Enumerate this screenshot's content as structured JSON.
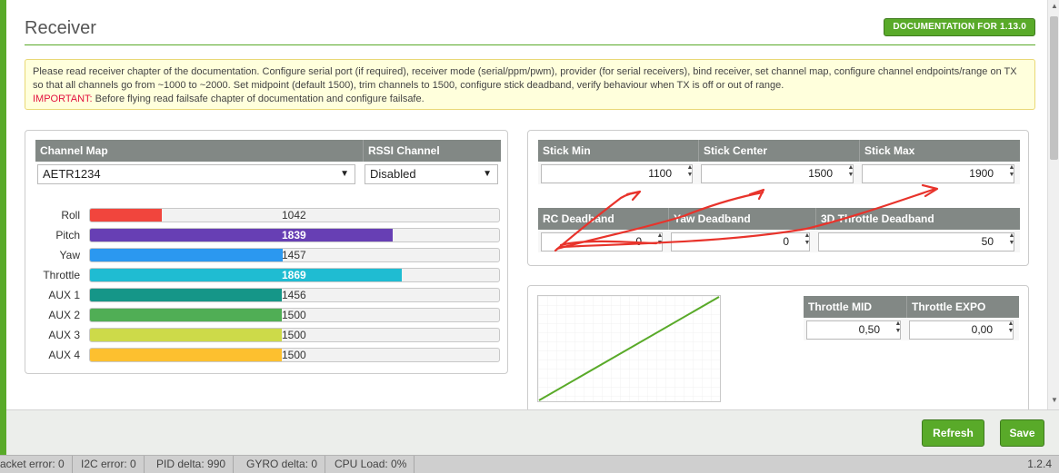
{
  "header": {
    "title": "Receiver",
    "doc_button": "DOCUMENTATION FOR 1.13.0"
  },
  "note": {
    "text": "Please read receiver chapter of the documentation. Configure serial port (if required), receiver mode (serial/ppm/pwm), provider (for serial receivers), bind receiver, set channel map, configure channel endpoints/range on TX so that all channels go from ~1000 to ~2000. Set midpoint (default 1500), trim channels to 1500, configure stick deadband, verify behaviour when TX is off or out of range.",
    "important_label": "IMPORTANT:",
    "important_text": " Before flying read failsafe chapter of documentation and configure failsafe."
  },
  "channel_map": {
    "header": "Channel Map",
    "value": "AETR1234"
  },
  "rssi": {
    "header": "RSSI Channel",
    "value": "Disabled"
  },
  "channels": [
    {
      "label": "Roll",
      "value": "1042",
      "fraction": 0.176,
      "color": "#f1453d"
    },
    {
      "label": "Pitch",
      "value": "1839",
      "fraction": 0.741,
      "color": "#673fb4"
    },
    {
      "label": "Yaw",
      "value": "1457",
      "fraction": 0.471,
      "color": "#2b98f0"
    },
    {
      "label": "Throttle",
      "value": "1869",
      "fraction": 0.763,
      "color": "#1fbcd2"
    },
    {
      "label": "AUX 1",
      "value": "1456",
      "fraction": 0.469,
      "color": "#159688"
    },
    {
      "label": "AUX 2",
      "value": "1500",
      "fraction": 0.469,
      "color": "#50ae55"
    },
    {
      "label": "AUX 3",
      "value": "1500",
      "fraction": 0.469,
      "color": "#cdda49"
    },
    {
      "label": "AUX 4",
      "value": "1500",
      "fraction": 0.469,
      "color": "#fdc02f"
    }
  ],
  "stick": {
    "min_label": "Stick Min",
    "min_value": "1100",
    "center_label": "Stick Center",
    "center_value": "1500",
    "max_label": "Stick Max",
    "max_value": "1900",
    "rc_deadband_label": "RC Deadband",
    "rc_deadband_value": "0",
    "yaw_deadband_label": "Yaw Deadband",
    "yaw_deadband_value": "0",
    "throttle3d_deadband_label": "3D Throttle Deadband",
    "throttle3d_deadband_value": "50"
  },
  "throttle": {
    "mid_label": "Throttle MID",
    "mid_value": "0,50",
    "expo_label": "Throttle EXPO",
    "expo_value": "0,00"
  },
  "footer": {
    "refresh": "Refresh",
    "save": "Save"
  },
  "status": {
    "packet_error": "acket error: 0",
    "i2c_error": "I2C error: 0",
    "pid_delta": "PID delta: 990",
    "gyro_delta": "GYRO delta: 0",
    "cpu_load": "CPU Load: 0%",
    "version": "1.2.4"
  },
  "colors": {
    "accent": "#59aa29",
    "header_bg": "#828885",
    "annotation": "#e8332b"
  }
}
